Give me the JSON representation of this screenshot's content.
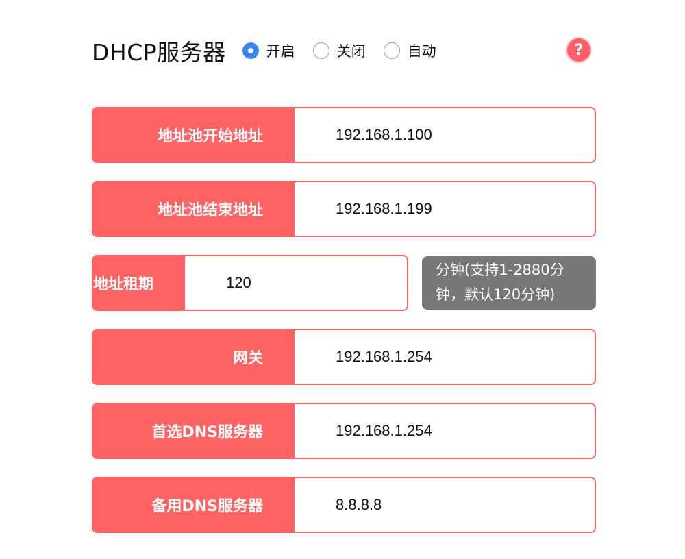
{
  "header": {
    "title": "DHCP服务器",
    "radios": [
      {
        "label": "开启",
        "checked": true
      },
      {
        "label": "关闭",
        "checked": false
      },
      {
        "label": "自动",
        "checked": false
      }
    ],
    "help_icon": "help-icon",
    "help_glyph": "?"
  },
  "fields": {
    "pool_start": {
      "label": "地址池开始地址",
      "value": "192.168.1.100"
    },
    "pool_end": {
      "label": "地址池结束地址",
      "value": "192.168.1.199"
    },
    "lease": {
      "label": "地址租期",
      "value": "120",
      "tip": "分钟(支持1-2880分\n钟，默认120分钟)"
    },
    "gateway": {
      "label": "网关",
      "value": "192.168.1.254"
    },
    "primary_dns": {
      "label": "首选DNS服务器",
      "value": "192.168.1.254"
    },
    "secondary_dns": {
      "label": "备用DNS服务器",
      "value": "8.8.8.8"
    }
  },
  "colors": {
    "accent": "#ff6363",
    "radio_checked": "#3a86f0",
    "tip_bg": "#777777"
  }
}
